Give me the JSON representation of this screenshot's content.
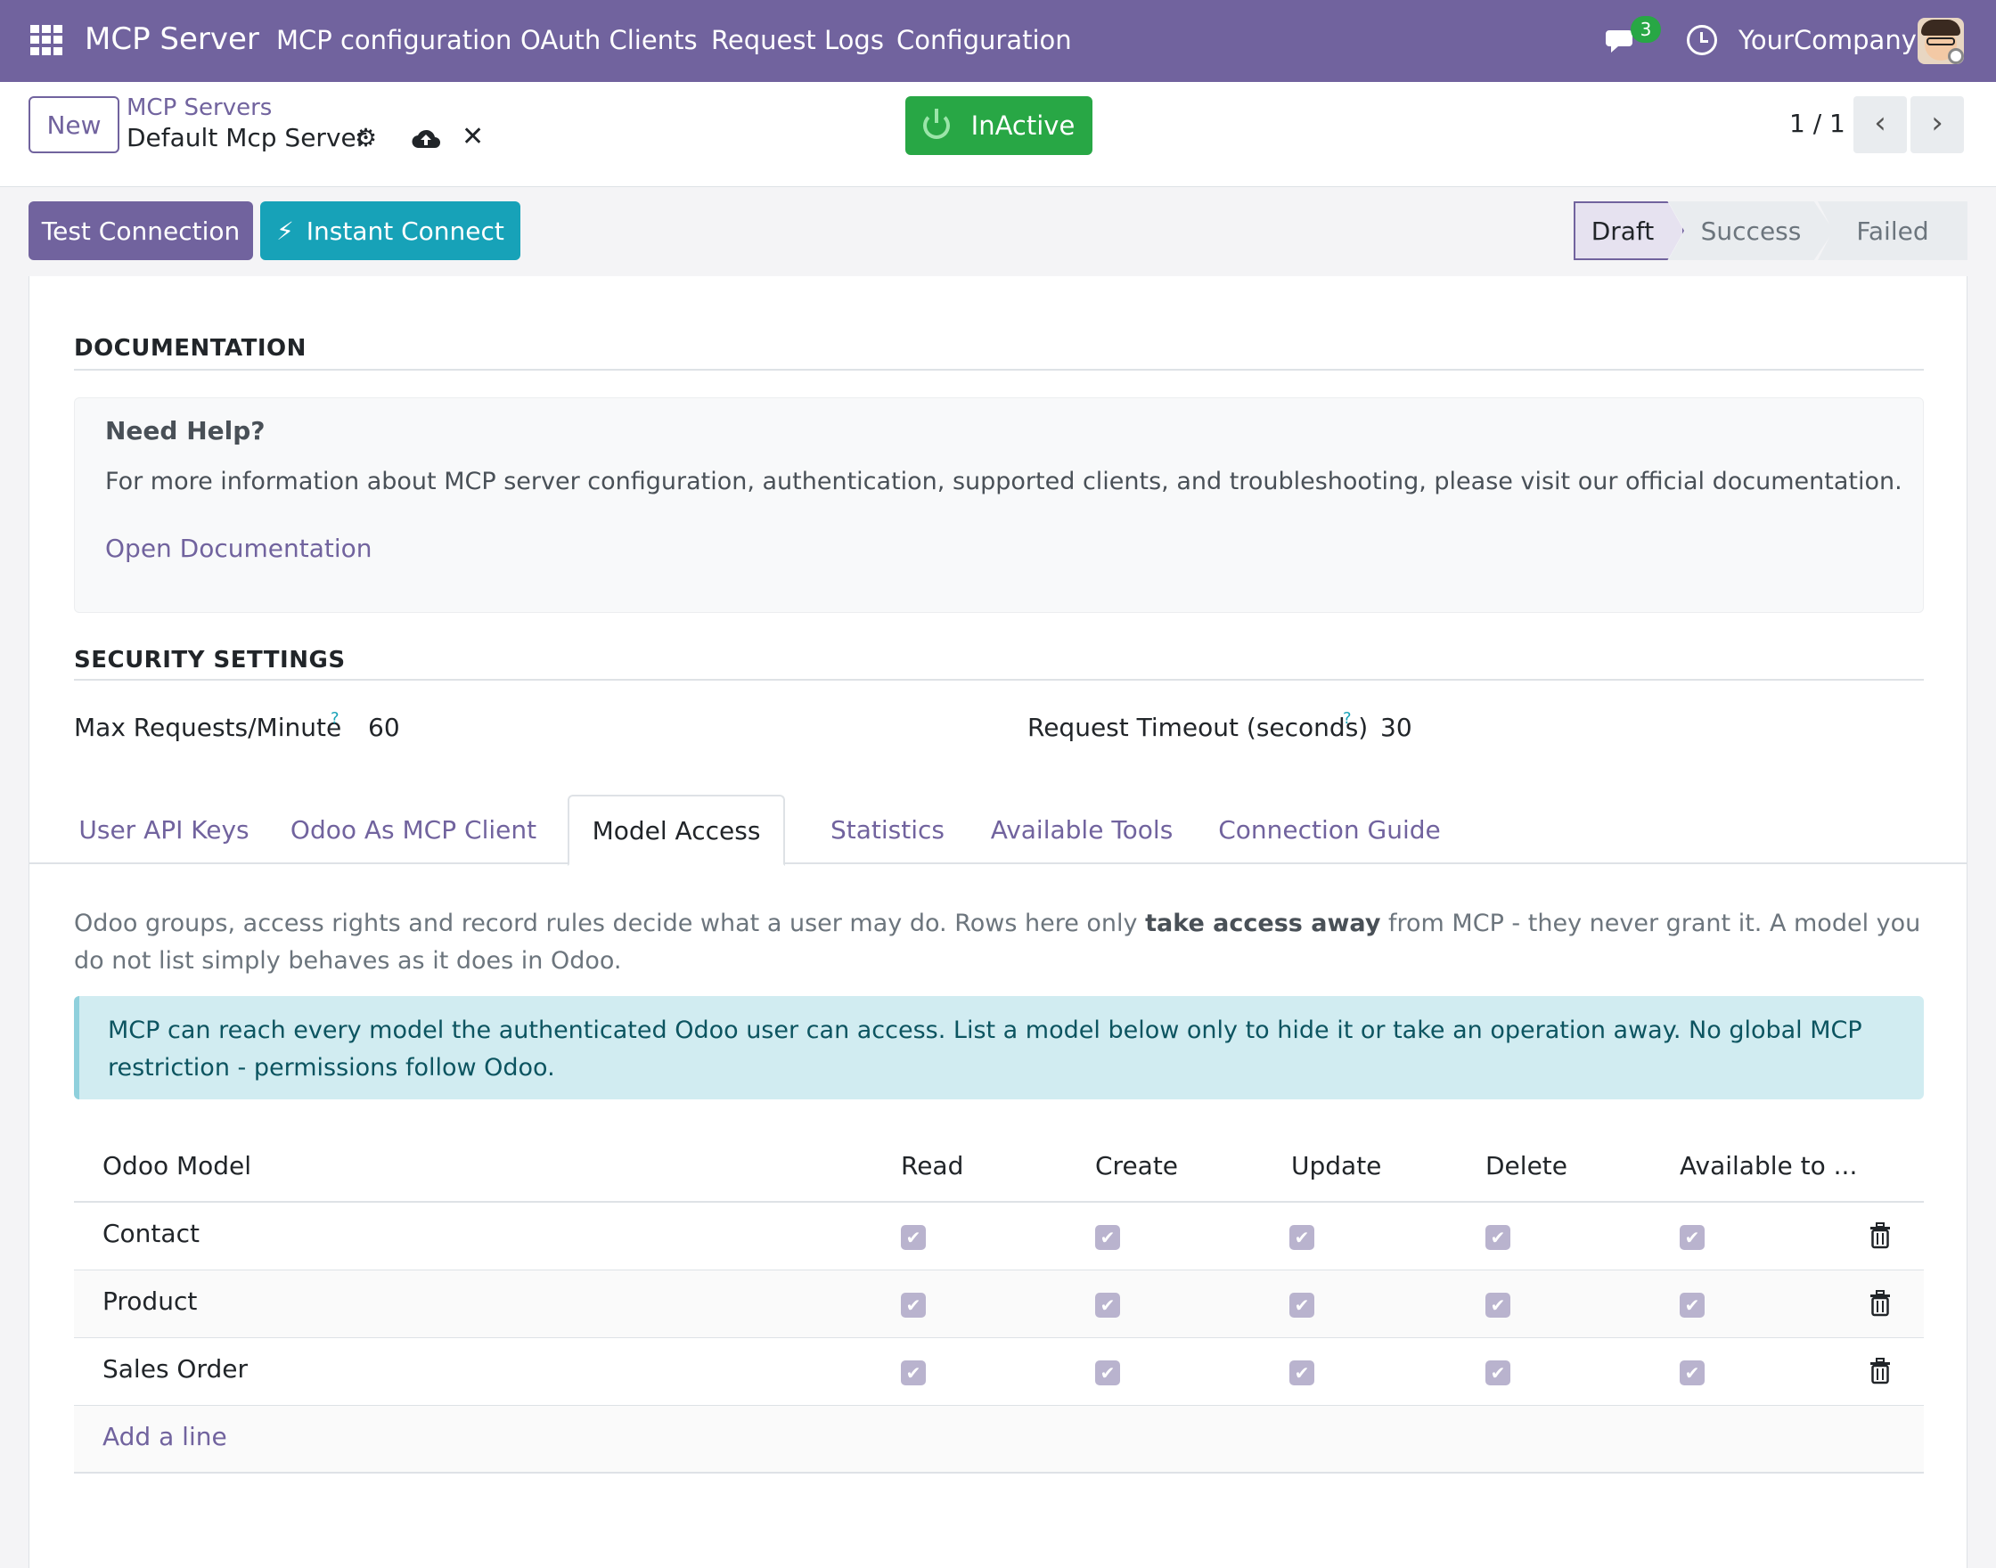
{
  "navbar": {
    "app_name": "MCP Server",
    "menu": [
      "MCP configuration",
      "OAuth Clients",
      "Request Logs",
      "Configuration"
    ],
    "chat_count": "3",
    "company": "YourCompany"
  },
  "control_panel": {
    "new_label": "New",
    "breadcrumb_parent": "MCP Servers",
    "record_title": "Default Mcp Server",
    "status_button": "InActive",
    "pager": "1 / 1"
  },
  "header_buttons": {
    "test_connection": "Test Connection",
    "instant_connect": "Instant Connect"
  },
  "stages": [
    "Draft",
    "Success",
    "Failed"
  ],
  "documentation": {
    "section_title": "DOCUMENTATION",
    "help_title": "Need Help?",
    "help_text": "For more information about MCP server configuration, authentication, supported clients, and troubleshooting, please visit our official documentation.",
    "link": "Open Documentation"
  },
  "security": {
    "section_title": "SECURITY SETTINGS",
    "max_requests_label": "Max Requests/Minute",
    "max_requests_value": "60",
    "timeout_label": "Request Timeout (seconds)",
    "timeout_value": "30",
    "help_mark": "?"
  },
  "tabs": [
    "User API Keys",
    "Odoo As MCP Client",
    "Model Access",
    "Statistics",
    "Available Tools",
    "Connection Guide"
  ],
  "model_access": {
    "desc_part1": "Odoo groups, access rights and record rules decide what a user may do. Rows here only ",
    "desc_bold": "take access away",
    "desc_part2": " from MCP - they never grant it. A model you do not list simply behaves as it does in Odoo.",
    "alert": "MCP can reach every model the authenticated Odoo user can access. List a model below only to hide it or take an operation away. No global MCP restriction - permissions follow Odoo.",
    "columns": [
      "Odoo Model",
      "Read",
      "Create",
      "Update",
      "Delete",
      "Available to ..."
    ],
    "rows": [
      {
        "model": "Contact",
        "read": true,
        "create": true,
        "update": true,
        "delete": true,
        "available": true
      },
      {
        "model": "Product",
        "read": true,
        "create": true,
        "update": true,
        "delete": true,
        "available": true
      },
      {
        "model": "Sales Order",
        "read": true,
        "create": true,
        "update": true,
        "delete": true,
        "available": true
      }
    ],
    "add_line": "Add a line"
  },
  "colors": {
    "brand": "#71639e",
    "success": "#28a745",
    "info": "#17a2b8",
    "alert_bg": "#d1ecf1"
  }
}
